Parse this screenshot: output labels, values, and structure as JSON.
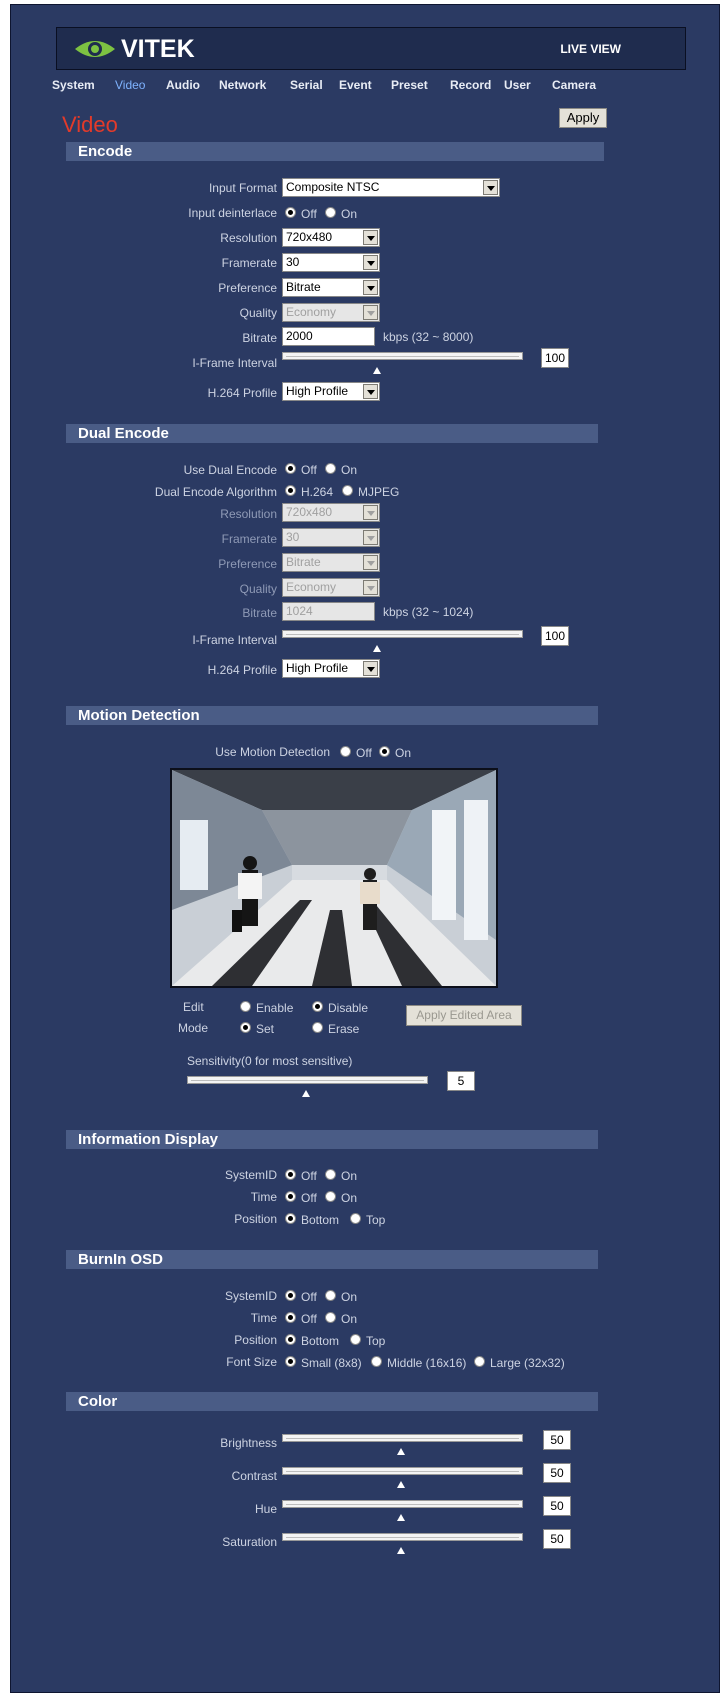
{
  "header": {
    "brand": "VITEK",
    "live_view": "LIVE VIEW"
  },
  "nav": [
    "System",
    "Video",
    "Audio",
    "Network",
    "Serial",
    "Event",
    "Preset",
    "Record",
    "User",
    "Camera"
  ],
  "page": {
    "title": "Video",
    "apply_label": "Apply"
  },
  "encode": {
    "title": "Encode",
    "input_format_label": "Input Format",
    "input_format_value": "Composite NTSC",
    "deinterlace_label": "Input deinterlace",
    "off_label": "Off",
    "on_label": "On",
    "resolution_label": "Resolution",
    "resolution_value": "720x480",
    "framerate_label": "Framerate",
    "framerate_value": "30",
    "preference_label": "Preference",
    "preference_value": "Bitrate",
    "quality_label": "Quality",
    "quality_value": "Economy",
    "bitrate_label": "Bitrate",
    "bitrate_value": "2000",
    "bitrate_range": "kbps (32 ~ 8000)",
    "iframe_label": "I-Frame Interval",
    "iframe_value": "100",
    "profile_label": "H.264 Profile",
    "profile_value": "High Profile"
  },
  "dual": {
    "title": "Dual Encode",
    "use_label": "Use Dual Encode",
    "off_label": "Off",
    "on_label": "On",
    "algo_label": "Dual Encode Algorithm",
    "algo_h264": "H.264",
    "algo_mjpeg": "MJPEG",
    "resolution_label": "Resolution",
    "resolution_value": "720x480",
    "framerate_label": "Framerate",
    "framerate_value": "30",
    "preference_label": "Preference",
    "preference_value": "Bitrate",
    "quality_label": "Quality",
    "quality_value": "Economy",
    "bitrate_label": "Bitrate",
    "bitrate_value": "1024",
    "bitrate_range": "kbps (32 ~ 1024)",
    "iframe_label": "I-Frame Interval",
    "iframe_value": "100",
    "profile_label": "H.264 Profile",
    "profile_value": "High Profile"
  },
  "motion": {
    "title": "Motion Detection",
    "use_label": "Use Motion Detection",
    "off_label": "Off",
    "on_label": "On",
    "edit_label": "Edit",
    "enable_label": "Enable",
    "disable_label": "Disable",
    "mode_label": "Mode",
    "set_label": "Set",
    "erase_label": "Erase",
    "apply_area_label": "Apply Edited Area",
    "sensitivity_label": "Sensitivity(0 for most sensitive)",
    "sensitivity_value": "5"
  },
  "info": {
    "title": "Information Display",
    "systemid_label": "SystemID",
    "time_label": "Time",
    "position_label": "Position",
    "off_label": "Off",
    "on_label": "On",
    "bottom_label": "Bottom",
    "top_label": "Top"
  },
  "burnin": {
    "title": "BurnIn OSD",
    "systemid_label": "SystemID",
    "time_label": "Time",
    "position_label": "Position",
    "fontsize_label": "Font Size",
    "off_label": "Off",
    "on_label": "On",
    "bottom_label": "Bottom",
    "top_label": "Top",
    "small_label": "Small (8x8)",
    "middle_label": "Middle (16x16)",
    "large_label": "Large (32x32)"
  },
  "color": {
    "title": "Color",
    "brightness_label": "Brightness",
    "brightness_value": "50",
    "contrast_label": "Contrast",
    "contrast_value": "50",
    "hue_label": "Hue",
    "hue_value": "50",
    "saturation_label": "Saturation",
    "saturation_value": "50"
  },
  "colors": {
    "background": "#2b3a63",
    "section": "#4a5c86",
    "title": "#e33a2a",
    "active_nav": "#7fb3ff"
  }
}
